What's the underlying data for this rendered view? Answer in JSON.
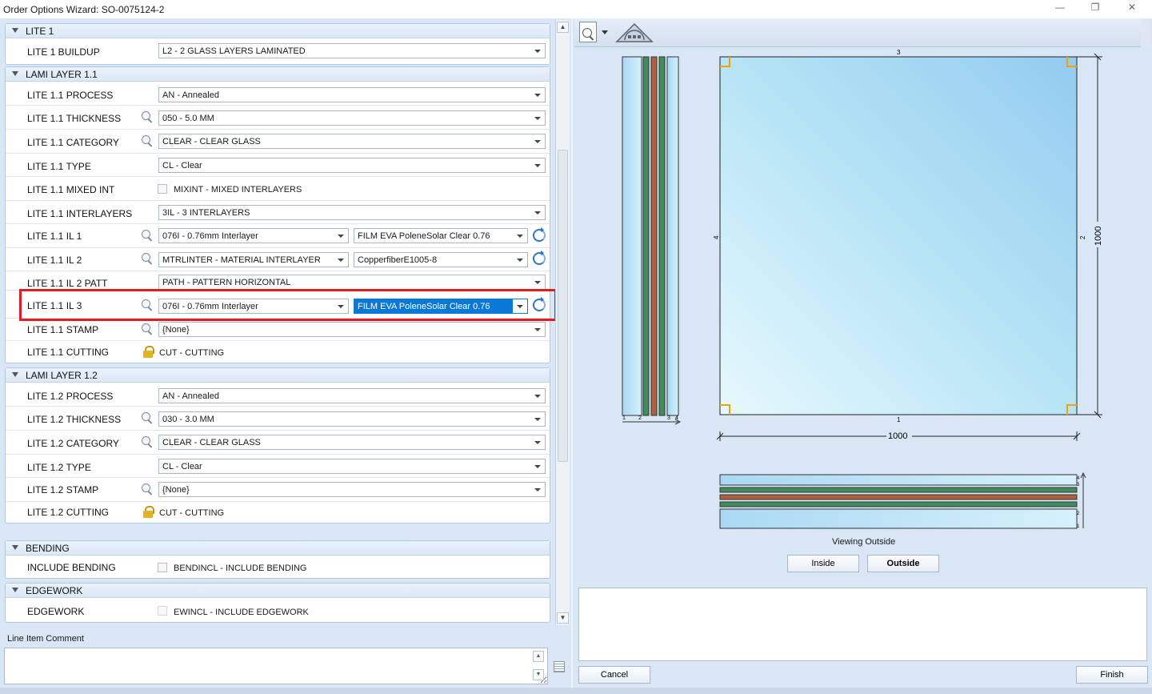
{
  "window": {
    "title": "Order Options Wizard: SO-0075124-2"
  },
  "groups": {
    "lite1": {
      "title": "LITE 1",
      "buildup_label": "LITE 1 BUILDUP",
      "buildup_value": "L2 - 2 GLASS LAYERS LAMINATED"
    },
    "lami11": {
      "title": "LAMI LAYER 1.1",
      "process_label": "LITE 1.1 PROCESS",
      "process_value": "AN - Annealed",
      "thickness_label": "LITE 1.1 THICKNESS",
      "thickness_value": "050 - 5.0 MM",
      "category_label": "LITE 1.1 CATEGORY",
      "category_value": "CLEAR - CLEAR GLASS",
      "type_label": "LITE 1.1 TYPE",
      "type_value": "CL - Clear",
      "mixed_label": "LITE 1.1 MIXED INT",
      "mixed_value": "MIXINT - MIXED INTERLAYERS",
      "interlayers_label": "LITE 1.1 INTERLAYERS",
      "interlayers_value": "3IL - 3 INTERLAYERS",
      "il1_label": "LITE 1.1 IL 1",
      "il1_value": "076I - 0.76mm Interlayer",
      "il1_material": "FILM EVA PoleneSolar Clear 0.76",
      "il2_label": "LITE 1.1 IL 2",
      "il2_value": "MTRLINTER - MATERIAL INTERLAYER",
      "il2_material": "CopperfiberE1005-8",
      "il2patt_label": "LITE 1.1 IL 2 PATT",
      "il2patt_value": "PATH - PATTERN HORIZONTAL",
      "il3_label": "LITE 1.1 IL 3",
      "il3_value": "076I - 0.76mm Interlayer",
      "il3_material": "FILM EVA PoleneSolar Clear 0.76",
      "stamp_label": "LITE 1.1 STAMP",
      "stamp_value": "{None}",
      "cutting_label": "LITE 1.1 CUTTING",
      "cutting_value": "CUT - CUTTING"
    },
    "lami12": {
      "title": "LAMI LAYER 1.2",
      "process_label": "LITE 1.2 PROCESS",
      "process_value": "AN - Annealed",
      "thickness_label": "LITE 1.2 THICKNESS",
      "thickness_value": "030 - 3.0 MM",
      "category_label": "LITE 1.2 CATEGORY",
      "category_value": "CLEAR - CLEAR GLASS",
      "type_label": "LITE 1.2 TYPE",
      "type_value": "CL - Clear",
      "stamp_label": "LITE 1.2 STAMP",
      "stamp_value": "{None}",
      "cutting_label": "LITE 1.2 CUTTING",
      "cutting_value": "CUT - CUTTING"
    },
    "bending": {
      "title": "BENDING",
      "label": "INCLUDE BENDING",
      "value": "BENDINCL - INCLUDE BENDING"
    },
    "edgework": {
      "title": "EDGEWORK",
      "label": "EDGEWORK",
      "value": "EWINCL - INCLUDE EDGEWORK"
    }
  },
  "comment": {
    "label": "Line Item Comment"
  },
  "preview": {
    "width_dim": "1000",
    "height_dim": "1000",
    "edge_top": "3",
    "edge_bottom": "1",
    "edge_left": "4",
    "edge_right": "2",
    "stack_nums": [
      "1",
      "2",
      "3",
      "4"
    ],
    "viewing_label": "Viewing Outside",
    "inside_label": "Inside",
    "outside_label": "Outside"
  },
  "footer": {
    "cancel_label": "Cancel",
    "finish_label": "Finish"
  },
  "colors": {
    "glass": "#bfe6f7",
    "interlayer_green": "#3f8c5e",
    "interlayer_copper": "#b0603e",
    "highlight": "#e01b22",
    "selected": "#0a78d7"
  }
}
